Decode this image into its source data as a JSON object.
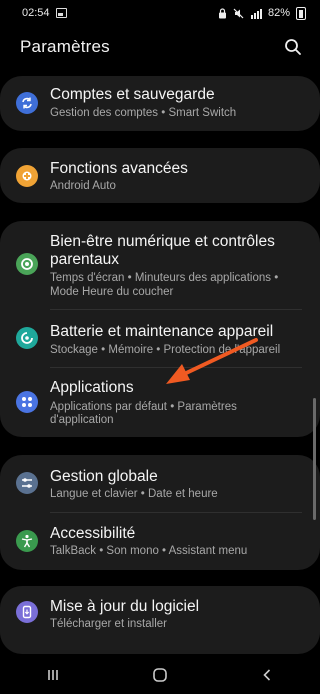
{
  "status": {
    "time": "02:54",
    "battery": "82%"
  },
  "header": {
    "title": "Paramètres"
  },
  "groups": [
    {
      "items": [
        {
          "title": "Comptes et sauvegarde",
          "subtitle": "Gestion des comptes  •  Smart Switch",
          "icon": "sync-icon",
          "color": "#3f6fd8"
        }
      ]
    },
    {
      "items": [
        {
          "title": "Fonctions avancées",
          "subtitle": "Android Auto",
          "icon": "plus-gear-icon",
          "color": "#f0a335"
        }
      ]
    },
    {
      "items": [
        {
          "title_line1": "Bien-être numérique et contrôles",
          "title_line2": "parentaux",
          "subtitle_line1": "Temps d'écran  •  Minuteurs des applications  •",
          "subtitle_line2": "Mode Heure du coucher",
          "icon": "wellbeing-icon",
          "color": "#4aa458"
        },
        {
          "title": "Batterie et maintenance appareil",
          "subtitle": "Stockage  •  Mémoire  •  Protection de l'appareil",
          "icon": "device-care-icon",
          "color": "#1fa89b"
        },
        {
          "title": "Applications",
          "subtitle_line1": "Applications par défaut  •  Paramètres",
          "subtitle_line2": "d'application",
          "icon": "apps-grid-icon",
          "color": "#4a74e2"
        }
      ]
    },
    {
      "items": [
        {
          "title": "Gestion globale",
          "subtitle": "Langue et clavier  •  Date et heure",
          "icon": "sliders-icon",
          "color": "#5a7190"
        },
        {
          "title": "Accessibilité",
          "subtitle": "TalkBack  •  Son mono  •  Assistant menu",
          "icon": "accessibility-icon",
          "color": "#3a9a4e"
        }
      ]
    },
    {
      "items": [
        {
          "title": "Mise à jour du logiciel",
          "subtitle": "Télécharger et installer",
          "icon": "software-update-icon",
          "color": "#7a6fd8"
        }
      ]
    }
  ],
  "colors": {
    "annotation_arrow": "#f05a22"
  }
}
